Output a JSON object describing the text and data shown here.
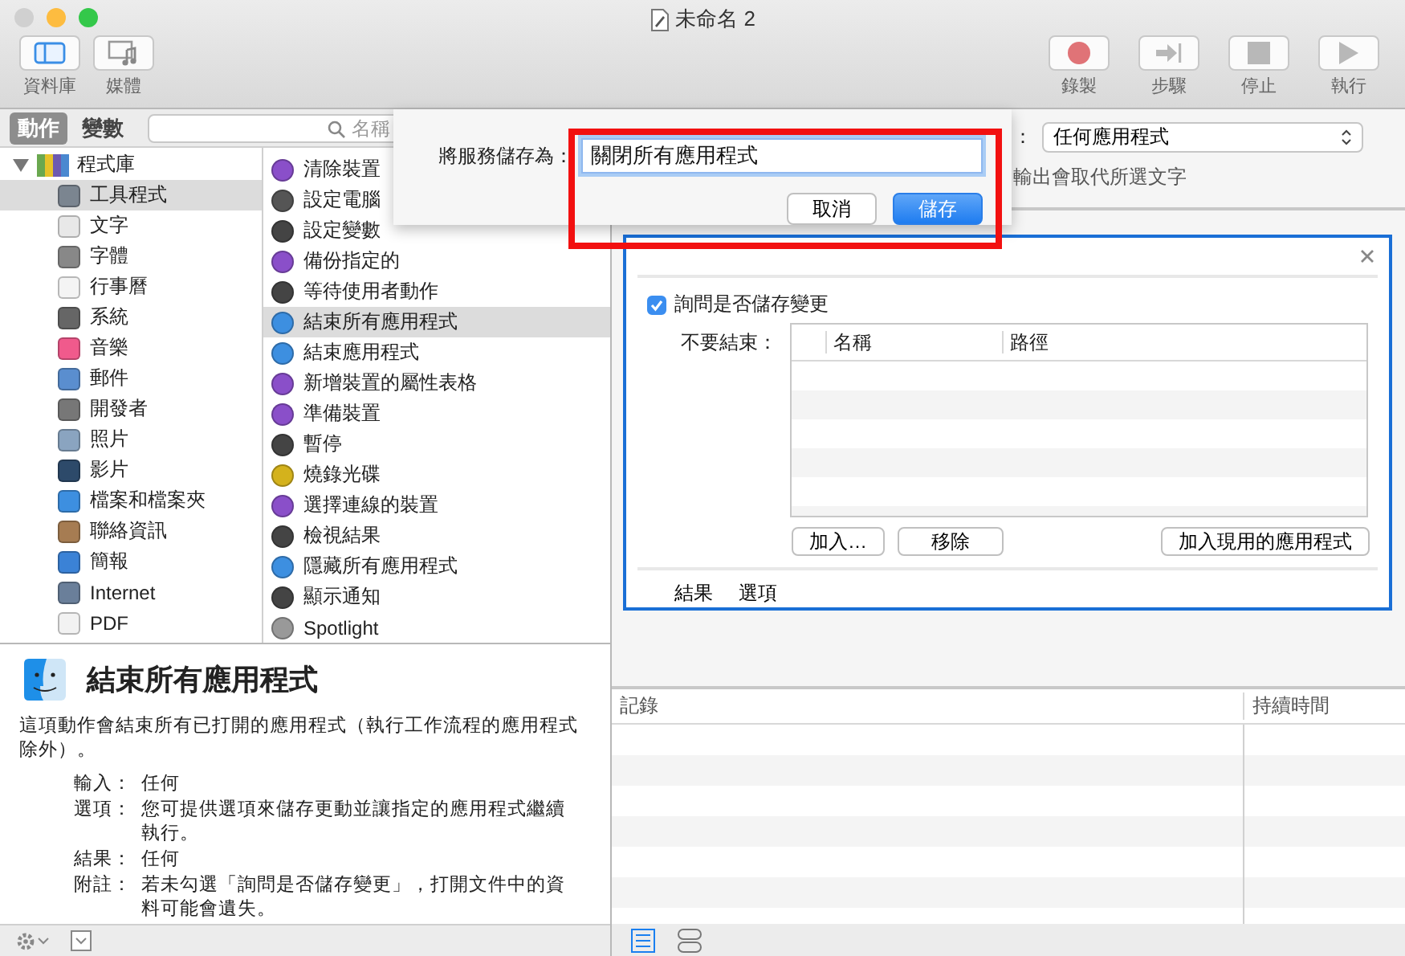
{
  "window": {
    "title": "未命名 2"
  },
  "toolbar": {
    "left": [
      {
        "label": "資料庫",
        "kind": "library"
      },
      {
        "label": "媒體",
        "kind": "media"
      }
    ],
    "right": [
      {
        "label": "錄製",
        "kind": "record"
      },
      {
        "label": "步驟",
        "kind": "step"
      },
      {
        "label": "停止",
        "kind": "stop"
      },
      {
        "label": "執行",
        "kind": "run"
      }
    ]
  },
  "library": {
    "tabs": [
      {
        "label": "動作",
        "selected": true
      },
      {
        "label": "變數",
        "selected": false
      }
    ],
    "search": {
      "placeholder": "名稱"
    },
    "tree": [
      {
        "label": "程式庫",
        "expanded": true,
        "children": [
          {
            "label": "工具程式",
            "selected": true
          },
          {
            "label": "文字",
            "selected": false
          },
          {
            "label": "字體",
            "selected": false
          },
          {
            "label": "行事曆",
            "selected": false
          },
          {
            "label": "系統",
            "selected": false
          },
          {
            "label": "音樂",
            "selected": false
          },
          {
            "label": "郵件",
            "selected": false
          },
          {
            "label": "開發者",
            "selected": false
          },
          {
            "label": "照片",
            "selected": false
          },
          {
            "label": "影片",
            "selected": false
          },
          {
            "label": "檔案和檔案夾",
            "selected": false
          },
          {
            "label": "聯絡資訊",
            "selected": false
          },
          {
            "label": "簡報",
            "selected": false
          },
          {
            "label": "Internet",
            "selected": false
          },
          {
            "label": "PDF",
            "selected": false
          }
        ]
      }
    ],
    "actions": [
      {
        "label": "清除裝置",
        "selected": false
      },
      {
        "label": "設定電腦",
        "selected": false
      },
      {
        "label": "設定變數",
        "selected": false
      },
      {
        "label": "備份指定的",
        "selected": false
      },
      {
        "label": "等待使用者動作",
        "selected": false
      },
      {
        "label": "結束所有應用程式",
        "selected": true
      },
      {
        "label": "結束應用程式",
        "selected": false
      },
      {
        "label": "新增裝置的屬性表格",
        "selected": false
      },
      {
        "label": "準備裝置",
        "selected": false
      },
      {
        "label": "暫停",
        "selected": false
      },
      {
        "label": "燒錄光碟",
        "selected": false
      },
      {
        "label": "選擇連線的裝置",
        "selected": false
      },
      {
        "label": "檢視結果",
        "selected": false
      },
      {
        "label": "隱藏所有應用程式",
        "selected": false
      },
      {
        "label": "顯示通知",
        "selected": false
      },
      {
        "label": "Spotlight",
        "selected": false
      }
    ],
    "description": {
      "title": "結束所有應用程式",
      "summary": "這項動作會結束所有已打開的應用程式（執行工作流程的應用程式除外）。",
      "details": [
        {
          "term": "輸入：",
          "text": "任何"
        },
        {
          "term": "選項：",
          "text": "您可提供選項來儲存更動並讓指定的應用程式繼續執行。"
        },
        {
          "term": "結果：",
          "text": "任何"
        },
        {
          "term": "附註：",
          "text": "若未勾選「詢問是否儲存變更」，打開文件中的資料可能會遺失。"
        }
      ]
    }
  },
  "workflow": {
    "previous_action": {
      "colon": "：",
      "popup": "任何應用程式",
      "note": "輸出會取代所選文字"
    },
    "action_card": {
      "checkbox": {
        "label": "詢問是否儲存變更",
        "checked": true
      },
      "exceptions_label": "不要結束：",
      "columns": [
        "名稱",
        "路徑"
      ],
      "buttons": [
        "加入…",
        "移除",
        "加入現用的應用程式"
      ],
      "footer": [
        "結果",
        "選項"
      ]
    },
    "log": {
      "columns": [
        "記錄",
        "持續時間"
      ]
    },
    "view_buttons": [
      {
        "kind": "list",
        "selected": true
      },
      {
        "kind": "split",
        "selected": false
      }
    ]
  },
  "save_sheet": {
    "label": "將服務儲存為：",
    "value": "關閉所有應用程式",
    "buttons": [
      {
        "label": "取消",
        "default": false
      },
      {
        "label": "儲存",
        "default": true
      }
    ]
  }
}
